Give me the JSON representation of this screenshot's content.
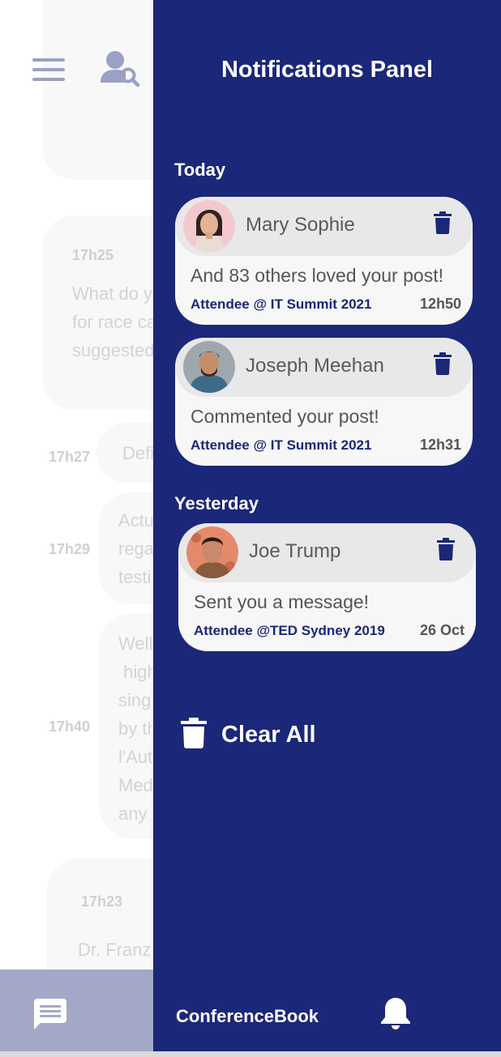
{
  "background_chat": {
    "messages": [
      {
        "time": "17h25",
        "text": "What do y\nfor race ca\nsuggested"
      },
      {
        "time": "17h27",
        "text": "Defi"
      },
      {
        "time": "17h29",
        "text": "Actu\nrega\ntesti"
      },
      {
        "time": "17h40",
        "text": "Well\n high\nsing\nby th\nl'Aut\nMed\nany"
      },
      {
        "time": "17h23",
        "text": "Dr. Franz"
      }
    ]
  },
  "panel": {
    "title": "Notifications Panel",
    "sections": [
      {
        "label": "Today",
        "items": [
          {
            "name": "Mary Sophie",
            "message": "And 83 others loved your post!",
            "event": "Attendee @ IT Summit 2021",
            "time": "12h50"
          },
          {
            "name": "Joseph Meehan",
            "message": "Commented your post!",
            "event": "Attendee @ IT Summit 2021",
            "time": "12h31"
          }
        ]
      },
      {
        "label": "Yesterday",
        "items": [
          {
            "name": "Joe Trump",
            "message": "Sent you a message!",
            "event": "Attendee @TED Sydney 2019",
            "time": "26 Oct"
          }
        ]
      }
    ],
    "clear_all_label": "Clear All"
  },
  "bottom_bar": {
    "brand": "ConferenceBook",
    "icons": [
      "chat-icon",
      "bell-icon"
    ]
  },
  "header_icons": [
    "menu-icon",
    "user-search-icon",
    "trash-icon"
  ],
  "colors": {
    "panel_bg": "#1b2778",
    "card_bg": "#f7f7f7",
    "card_header_bg": "#e8e8e8",
    "accent_text": "#1b2778",
    "bottom_bar_left": "#a4a8c7",
    "icon_muted": "#9aa0c6"
  }
}
